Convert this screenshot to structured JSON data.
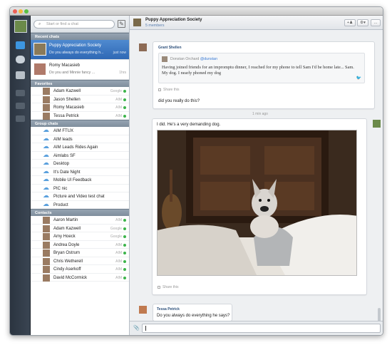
{
  "search": {
    "placeholder": "Start or find a chat"
  },
  "sections": {
    "recent": "Recent chats",
    "favorites": "Favorites",
    "groups": "Group chats",
    "contacts": "Contacts"
  },
  "recent": [
    {
      "title": "Puppy Appreciation Society",
      "snippet": "Do you always do everything h...",
      "time": "just now",
      "selected": true
    },
    {
      "title": "Romy Macasieb",
      "snippet": "Do you and Minnie fancy ...",
      "time": "1hrs",
      "selected": false
    }
  ],
  "favorites": [
    {
      "name": "Adam Kazwell",
      "service": "Google"
    },
    {
      "name": "Jason Shellen",
      "service": "AIM"
    },
    {
      "name": "Romy Macasieb",
      "service": "AIM"
    },
    {
      "name": "Tessa Petrick",
      "service": "AIM"
    }
  ],
  "groups": [
    {
      "name": "AIM FTUX"
    },
    {
      "name": "AIM leads"
    },
    {
      "name": "AIM Leads Rides Again"
    },
    {
      "name": "Aimlabs SF"
    },
    {
      "name": "Desktop"
    },
    {
      "name": "It's Date Night"
    },
    {
      "name": "Mobile UI Feedback"
    },
    {
      "name": "PIC nic"
    },
    {
      "name": "Picture and Video test chat"
    },
    {
      "name": "Product"
    }
  ],
  "contacts": [
    {
      "name": "Aaron Martin",
      "service": "AIM"
    },
    {
      "name": "Adam Kazwell",
      "service": "Google"
    },
    {
      "name": "Amy Hoeck",
      "service": "Google"
    },
    {
      "name": "Andrea Doyle",
      "service": "AIM"
    },
    {
      "name": "Bryan Ostrum",
      "service": "AIM"
    },
    {
      "name": "Chris Wetherell",
      "service": "AIM"
    },
    {
      "name": "Cindy Aserkoff",
      "service": "AIM"
    },
    {
      "name": "David McCormick",
      "service": "AIM"
    }
  ],
  "chat": {
    "title": "Puppy Appreciation Society",
    "members": "5 members"
  },
  "messages": {
    "grant_name": "Grant Shellen",
    "quote_author": "Donstan Orchard",
    "quote_handle": "@dunstan",
    "quote_text": "Having joined friends for an impromptu dinner, I reached for my phone to tell Sam I'd be home late... Sam. My dog. I nearly phoned my dog",
    "share_label": "Share this",
    "grant_reply": "did you really do this?",
    "timestamp": "1 min ago",
    "self_text": "I did. He's a very demanding dog.",
    "tessa_name": "Tessa Petrick",
    "tessa_text": "Do you always do everything he says?"
  },
  "colors": {
    "selection": "#3a74c0",
    "online": "#3cb44b",
    "section_header": "#8796a5"
  }
}
